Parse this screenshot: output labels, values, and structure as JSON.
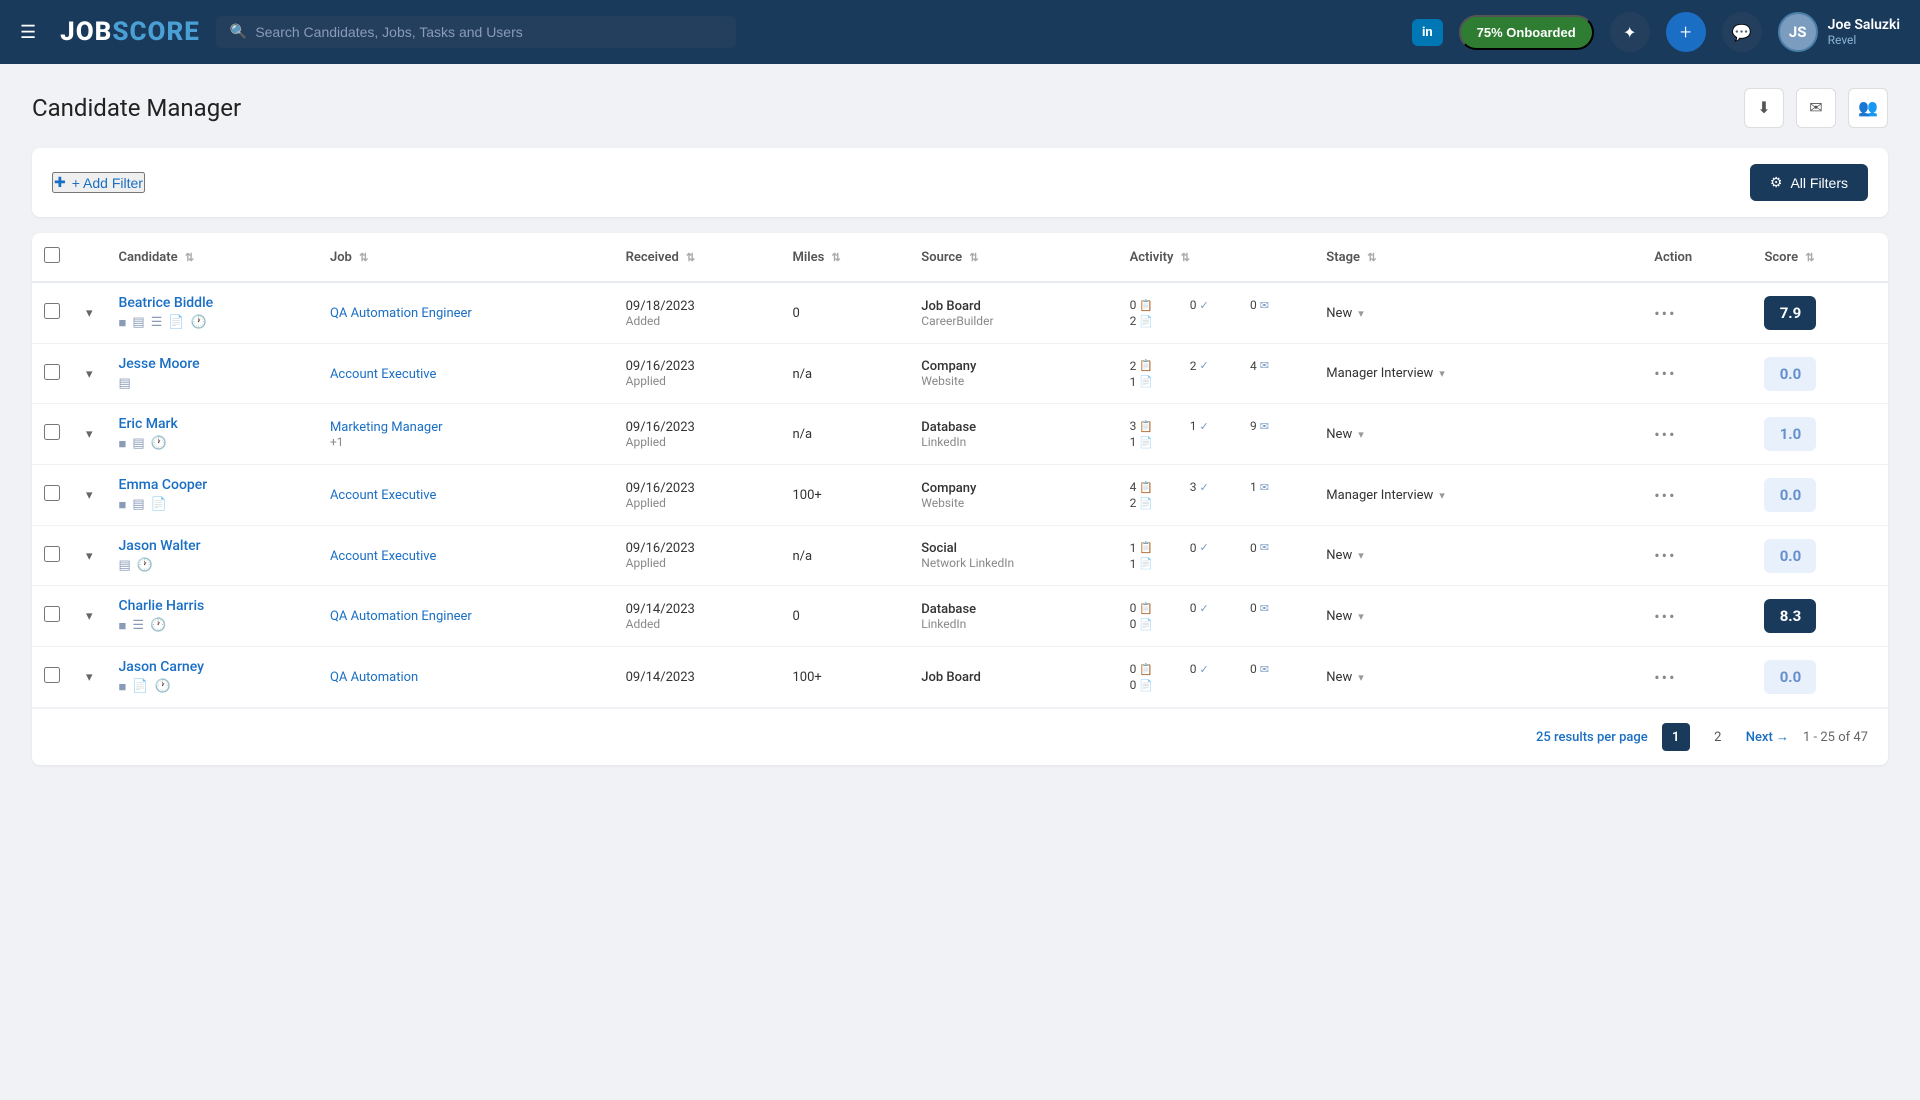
{
  "header": {
    "menu_label": "☰",
    "logo_job": "JOB",
    "logo_score": "SCORE",
    "search_placeholder": "Search Candidates, Jobs, Tasks and Users",
    "linkedin_label": "in",
    "onboard_label": "75% Onboarded",
    "user_name": "Joe Saluzki",
    "user_company": "Revel",
    "user_initials": "JS",
    "add_icon": "+",
    "message_icon": "💬",
    "magic_icon": "✦"
  },
  "page": {
    "title": "Candidate Manager",
    "download_icon": "⬇",
    "email_icon": "✉",
    "group_icon": "👥"
  },
  "filters": {
    "add_filter_label": "+ Add Filter",
    "all_filters_label": "All Filters"
  },
  "table": {
    "columns": [
      "Candidate",
      "Job",
      "Received",
      "Miles",
      "Source",
      "Activity",
      "Stage",
      "Action",
      "Score"
    ],
    "rows": [
      {
        "id": 1,
        "candidate_name": "Beatrice Biddle",
        "candidate_icons": [
          "■",
          "▤",
          "☰",
          "📄",
          "🕐"
        ],
        "job": "QA Automation Engineer",
        "job_extra": "",
        "received_date": "09/18/2023",
        "received_sub": "Added",
        "miles": "0",
        "source_main": "Job Board",
        "source_sub": "CareerBuilder",
        "activity": [
          [
            "0",
            "📋"
          ],
          [
            "0",
            "✓"
          ],
          [
            "0",
            "✉"
          ],
          [
            "2",
            "📄"
          ]
        ],
        "stage": "New",
        "score": "7.9",
        "score_style": "blue"
      },
      {
        "id": 2,
        "candidate_name": "Jesse Moore",
        "candidate_icons": [
          "▤"
        ],
        "job": "Account Executive",
        "job_extra": "",
        "received_date": "09/16/2023",
        "received_sub": "Applied",
        "miles": "n/a",
        "source_main": "Company",
        "source_sub": "Website",
        "activity": [
          [
            "2",
            "📋"
          ],
          [
            "2",
            "✓"
          ],
          [
            "4",
            "✉"
          ],
          [
            "1",
            "📄"
          ]
        ],
        "stage": "Manager Interview",
        "score": "0.0",
        "score_style": "light"
      },
      {
        "id": 3,
        "candidate_name": "Eric Mark",
        "candidate_icons": [
          "■",
          "▤",
          "🕐"
        ],
        "job": "Marketing Manager",
        "job_extra": "+1",
        "received_date": "09/16/2023",
        "received_sub": "Applied",
        "miles": "n/a",
        "source_main": "Database",
        "source_sub": "LinkedIn",
        "activity": [
          [
            "3",
            "📋"
          ],
          [
            "1",
            "✓"
          ],
          [
            "9",
            "✉"
          ],
          [
            "1",
            "📄"
          ]
        ],
        "stage": "New",
        "score": "1.0",
        "score_style": "light"
      },
      {
        "id": 4,
        "candidate_name": "Emma Cooper",
        "candidate_icons": [
          "■",
          "▤",
          "📄"
        ],
        "job": "Account Executive",
        "job_extra": "",
        "received_date": "09/16/2023",
        "received_sub": "Applied",
        "miles": "100+",
        "source_main": "Company",
        "source_sub": "Website",
        "activity": [
          [
            "4",
            "📋"
          ],
          [
            "3",
            "✓"
          ],
          [
            "1",
            "✉"
          ],
          [
            "2",
            "📄"
          ]
        ],
        "stage": "Manager Interview",
        "score": "0.0",
        "score_style": "light"
      },
      {
        "id": 5,
        "candidate_name": "Jason Walter",
        "candidate_icons": [
          "▤",
          "🕐"
        ],
        "job": "Account Executive",
        "job_extra": "",
        "received_date": "09/16/2023",
        "received_sub": "Applied",
        "miles": "n/a",
        "source_main": "Social",
        "source_sub": "Network LinkedIn",
        "activity": [
          [
            "1",
            "📋"
          ],
          [
            "0",
            "✓"
          ],
          [
            "0",
            "✉"
          ],
          [
            "1",
            "📄"
          ]
        ],
        "stage": "New",
        "score": "0.0",
        "score_style": "light"
      },
      {
        "id": 6,
        "candidate_name": "Charlie Harris",
        "candidate_icons": [
          "■",
          "☰",
          "🕐"
        ],
        "job": "QA Automation Engineer",
        "job_extra": "",
        "received_date": "09/14/2023",
        "received_sub": "Added",
        "miles": "0",
        "source_main": "Database",
        "source_sub": "LinkedIn",
        "activity": [
          [
            "0",
            "📋"
          ],
          [
            "0",
            "✓"
          ],
          [
            "0",
            "✉"
          ],
          [
            "0",
            "📄"
          ]
        ],
        "stage": "New",
        "score": "8.3",
        "score_style": "blue"
      },
      {
        "id": 7,
        "candidate_name": "Jason Carney",
        "candidate_icons": [
          "■",
          "📄",
          "🕐"
        ],
        "job": "QA Automation",
        "job_extra": "",
        "received_date": "09/14/2023",
        "received_sub": "",
        "miles": "100+",
        "source_main": "Job Board",
        "source_sub": "",
        "activity": [
          [
            "0",
            "📋"
          ],
          [
            "0",
            "✓"
          ],
          [
            "0",
            "✉"
          ],
          [
            "0",
            "📄"
          ]
        ],
        "stage": "New",
        "score": "0.0",
        "score_style": "light"
      }
    ]
  },
  "pagination": {
    "per_page": "25 results per page",
    "page_1": "1",
    "page_2": "2",
    "next_label": "Next →",
    "range_label": "1 - 25 of 47"
  }
}
